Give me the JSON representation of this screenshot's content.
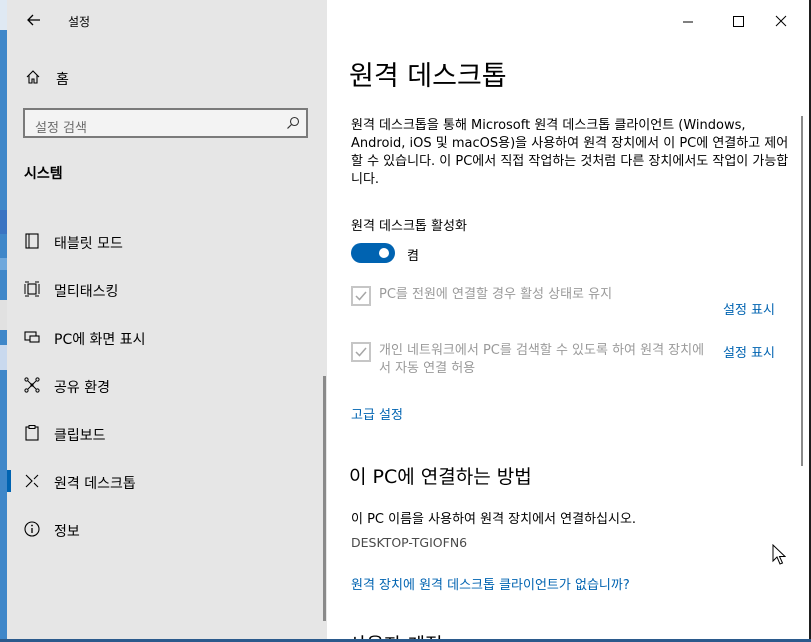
{
  "window": {
    "app_title": "설정",
    "controls": {
      "minimize_icon": "minimize-icon",
      "maximize_icon": "maximize-icon",
      "close_icon": "close-icon"
    }
  },
  "sidebar": {
    "home_label": "홈",
    "search_placeholder": "설정 검색",
    "section_title": "시스템",
    "items": [
      {
        "label": "태블릿 모드",
        "icon": "tablet-icon",
        "selected": false
      },
      {
        "label": "멀티태스킹",
        "icon": "multitasking-icon",
        "selected": false
      },
      {
        "label": "PC에 화면 표시",
        "icon": "project-icon",
        "selected": false
      },
      {
        "label": "공유 환경",
        "icon": "share-icon",
        "selected": false
      },
      {
        "label": "클립보드",
        "icon": "clipboard-icon",
        "selected": false
      },
      {
        "label": "원격 데스크톱",
        "icon": "remote-desktop-icon",
        "selected": true
      },
      {
        "label": "정보",
        "icon": "info-icon",
        "selected": false
      }
    ]
  },
  "main": {
    "title": "원격 데스크톱",
    "description": "원격 데스크톱을 통해 Microsoft 원격 데스크톱 클라이언트 (Windows, Android, iOS 및 macOS용)을 사용하여 원격 장치에서 이 PC에 연결하고 제어할 수 있습니다. 이 PC에서 직접 작업하는 것처럼 다른 장치에서도 작업이 가능합니다.",
    "enable_label": "원격 데스크톱 활성화",
    "toggle": {
      "on": true,
      "state_label": "켬"
    },
    "option1": {
      "label": "PC를 전원에 연결할 경우 활성 상태로 유지",
      "checked": true,
      "link": "설정 표시"
    },
    "option2": {
      "label": "개인 네트워크에서 PC를 검색할 수 있도록 하여 원격 장치에서 자동 연결 허용",
      "checked": true,
      "link": "설정 표시"
    },
    "advanced_link": "고급 설정",
    "connect_heading": "이 PC에 연결하는 방법",
    "connect_desc": "이 PC 이름을 사용하여 원격 장치에서 연결하십시오.",
    "pc_name": "DESKTOP-TGIOFN6",
    "no_client_link": "원격 장치에 원격 데스크톱 클라이언트가 없습니까?",
    "next_heading_partial": "사용자 계정"
  },
  "colors": {
    "accent": "#0063b1",
    "sidebar_bg": "#e6e6e6",
    "disabled_text": "#9a9a9a"
  }
}
